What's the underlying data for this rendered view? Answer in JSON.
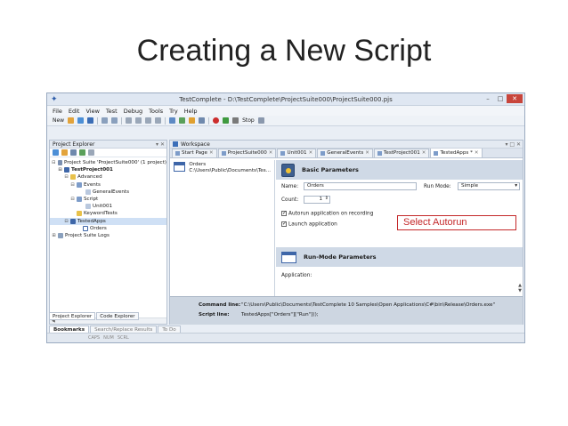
{
  "slide_title": "Creating a New Script",
  "window": {
    "title": "TestComplete - D:\\TestComplete\\ProjectSuite000\\ProjectSuite000.pjs",
    "min": "–",
    "max": "□",
    "close": "✕"
  },
  "menu": {
    "file": "File",
    "edit": "Edit",
    "view": "View",
    "test": "Test",
    "debug": "Debug",
    "tools": "Tools",
    "try": "Try",
    "help": "Help"
  },
  "toolbar": {
    "new_label": "New",
    "stop_label": "Stop"
  },
  "project_explorer": {
    "title": "Project Explorer",
    "pins": "▾ ✕",
    "tree": [
      {
        "label": "Project Suite 'ProjectSuite000' (1 project)",
        "exp": "⊟"
      },
      {
        "label": "TestProject001",
        "exp": "⊟"
      },
      {
        "label": "Advanced",
        "exp": "⊟"
      },
      {
        "label": "Events",
        "exp": "⊟"
      },
      {
        "label": "GeneralEvents",
        "exp": ""
      },
      {
        "label": "Script",
        "exp": "⊟"
      },
      {
        "label": "Unit001",
        "exp": ""
      },
      {
        "label": "KeywordTests",
        "exp": ""
      },
      {
        "label": "TestedApps",
        "exp": "⊟"
      },
      {
        "label": "Orders",
        "exp": ""
      },
      {
        "label": "Project Suite Logs",
        "exp": "⊞"
      }
    ],
    "tabs": {
      "project_explorer": "Project Explorer",
      "code_explorer": "Code Explorer"
    }
  },
  "workspace": {
    "title": "Workspace",
    "pins": "▾ □ ✕",
    "tabs": [
      {
        "label": "Start Page",
        "close": "✕"
      },
      {
        "label": "ProjectSuite000",
        "close": "✕"
      },
      {
        "label": "Unit001",
        "close": "✕"
      },
      {
        "label": "GeneralEvents",
        "close": "✕"
      },
      {
        "label": "TestProject001",
        "close": "✕"
      },
      {
        "label": "TestedApps *",
        "close": "✕"
      }
    ],
    "app_name": "Orders",
    "app_path": "C:\\Users\\Public\\Documents\\Tes..."
  },
  "basic_parameters": {
    "heading": "Basic Parameters",
    "name_label": "Name:",
    "name_value": "Orders",
    "run_mode_label": "Run Mode:",
    "run_mode_value": "Simple",
    "count_label": "Count:",
    "count_value": "1",
    "autorun_label": "Autorun application on recording",
    "autorun_checked": true,
    "launch_label": "Launch application",
    "launch_checked": true
  },
  "run_mode_parameters": {
    "heading": "Run-Mode Parameters",
    "application_label": "Application:"
  },
  "command": {
    "cmd_label": "Command line:",
    "cmd_value": "\"C:\\Users\\Public\\Documents\\TestComplete 10 Samples\\Open Applications\\C#\\bin\\Release\\Orders.exe\"",
    "script_label": "Script line:",
    "script_value": "TestedApps[\"Orders\"][\"Run\"]();"
  },
  "bottom_tabs": {
    "bookmarks": "Bookmarks",
    "search": "Search/Replace Results",
    "todo": "To Do"
  },
  "status": {
    "caps": "CAPS",
    "num": "NUM",
    "scrl": "SCRL"
  },
  "callout_text": "Select Autorun",
  "colors": {
    "callout": "#c4282a",
    "accent": "#3e66a8"
  }
}
